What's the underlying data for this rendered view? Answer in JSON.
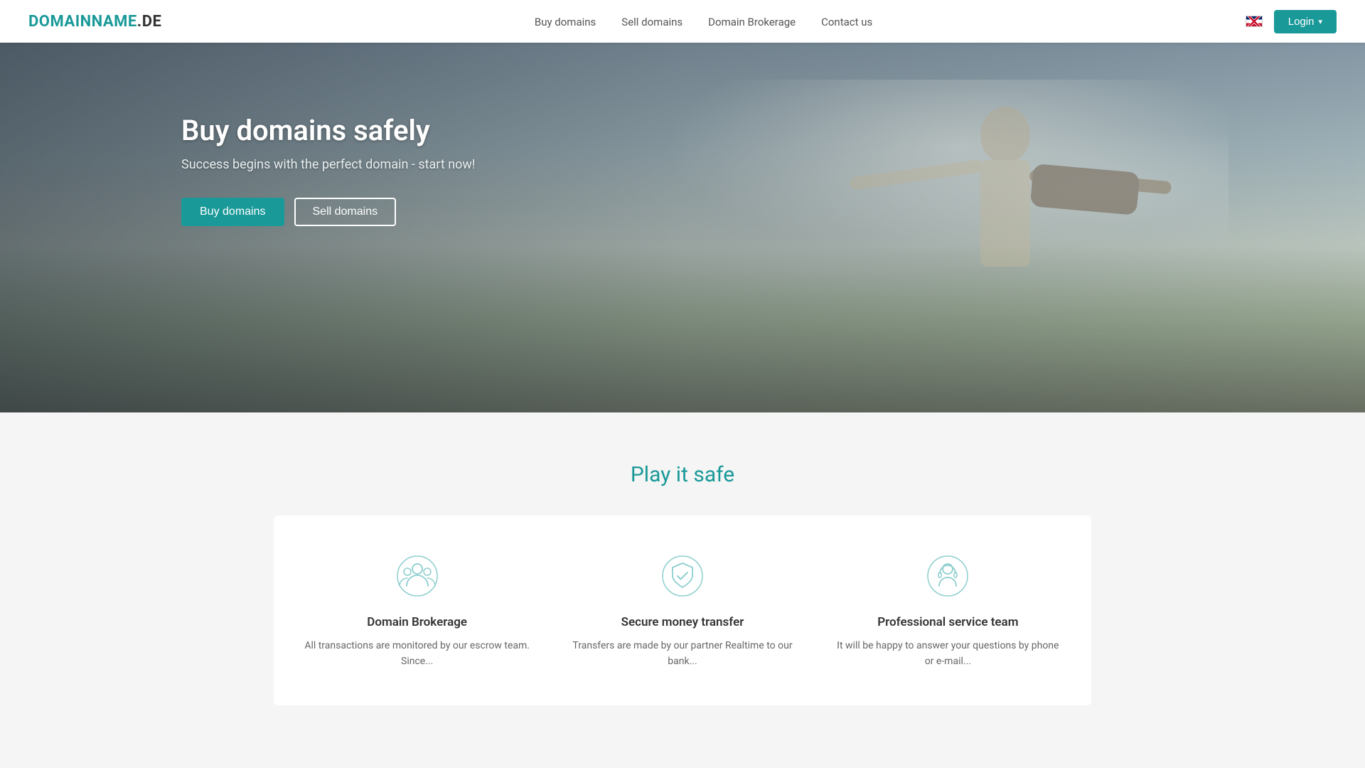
{
  "brand": {
    "logo_part1": "DOMAINNAME",
    "logo_separator": ".",
    "logo_tld": "DE"
  },
  "navbar": {
    "links": [
      {
        "id": "buy-domains",
        "label": "Buy domains",
        "href": "#"
      },
      {
        "id": "sell-domains",
        "label": "Sell domains",
        "href": "#"
      },
      {
        "id": "domain-brokerage",
        "label": "Domain Brokerage",
        "href": "#"
      },
      {
        "id": "contact-us",
        "label": "Contact us",
        "href": "#"
      }
    ],
    "login_label": "Login"
  },
  "hero": {
    "title": "Buy domains safely",
    "subtitle": "Success begins with the perfect domain - start now!",
    "btn_primary": "Buy domains",
    "btn_secondary": "Sell domains"
  },
  "section": {
    "title": "Play it safe",
    "cards": [
      {
        "id": "domain-brokerage-card",
        "icon": "people-icon",
        "title": "Domain Brokerage",
        "text": "All transactions are monitored by our escrow team. Since..."
      },
      {
        "id": "secure-money-card",
        "icon": "shield-check-icon",
        "title": "Secure money transfer",
        "text": "Transfers are made by our partner Realtime to our bank..."
      },
      {
        "id": "professional-team-card",
        "icon": "support-icon",
        "title": "Professional service team",
        "text": "It will be happy to answer your questions by phone or e-mail..."
      }
    ]
  }
}
